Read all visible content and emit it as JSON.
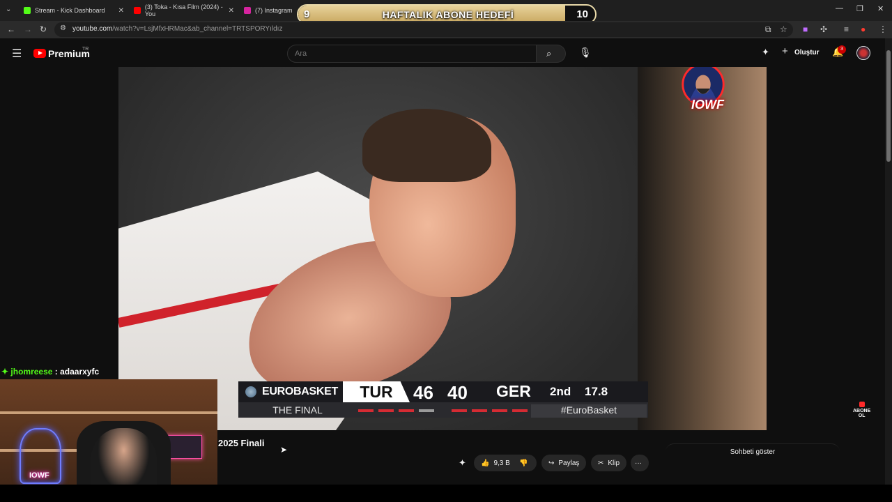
{
  "browser": {
    "tabs": [
      {
        "label": "Stream - Kick Dashboard",
        "favicon_color": "#53fc18"
      },
      {
        "label": "(3) Toka - Kısa Film (2024) - You",
        "favicon_color": "#ff0000"
      },
      {
        "label": "(7) Instagram",
        "favicon_color": "#d6249f"
      }
    ],
    "url_host": "youtube.com",
    "url_path": "/watch?v=LsjMfxHRMac&ab_channel=TRTSPORYıldız"
  },
  "goal_overlay": {
    "current": "9",
    "target": "10",
    "label": "HAFTALIK ABONE HEDEFİ",
    "progress": 0.9
  },
  "youtube": {
    "logo_text": "Premium",
    "region": "TR",
    "search_placeholder": "Ara",
    "create_label": "Oluştur",
    "notif_count": "3"
  },
  "scoreboard": {
    "brand": "EUROBASKET",
    "team_a": "TUR",
    "score_a": "46",
    "score_b": "40",
    "team_b": "GER",
    "period": "2nd",
    "clock": "17.8",
    "round": "THE FINAL",
    "hashtag": "#EuroBasket",
    "fouls_a": [
      1,
      1,
      1,
      0
    ],
    "fouls_b": [
      1,
      1,
      1,
      1
    ]
  },
  "watermark": "IOWF",
  "subscribe_badge": [
    "ABONE",
    "OL"
  ],
  "chat_overlay": {
    "user": "jhomreese",
    "sep": " : ",
    "message": "adaarxyfc"
  },
  "cam": {
    "neon_text": "IOWF"
  },
  "video_title_partial": "2025 Finali",
  "actions": {
    "likes": "9,3 B",
    "share": "Paylaş",
    "clip": "Klip",
    "more": "···"
  },
  "chat_toggle": "Sohbeti göster"
}
